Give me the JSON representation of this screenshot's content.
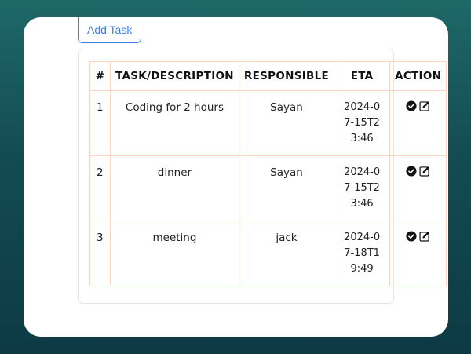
{
  "add_task_label": "Add Task",
  "table": {
    "headers": [
      "#",
      "TASK/DESCRIPTION",
      "RESPONSIBLE",
      "ETA",
      "ACTION"
    ],
    "rows": [
      {
        "num": "1",
        "task": "Coding for 2 hours",
        "responsible": "Sayan",
        "eta": "2024-07-15T23:46"
      },
      {
        "num": "2",
        "task": "dinner",
        "responsible": "Sayan",
        "eta": "2024-07-15T23:46"
      },
      {
        "num": "3",
        "task": "meeting",
        "responsible": "jack",
        "eta": "2024-07-18T19:49"
      }
    ]
  },
  "icons": {
    "complete": "check-circle-icon",
    "edit": "edit-icon"
  },
  "colors": {
    "button_border": "#3f7ff0",
    "table_border": "#fbd6c3",
    "background_top": "#1e6868",
    "background_bottom": "#0d3a44"
  }
}
